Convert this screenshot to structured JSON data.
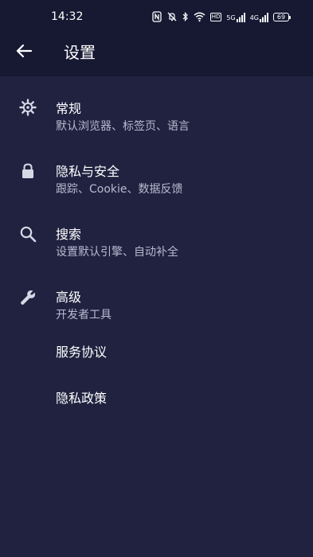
{
  "status_bar": {
    "time": "14:32",
    "network_5g": "5G",
    "network_4g": "4G",
    "hd": "HD",
    "battery": "69"
  },
  "app_bar": {
    "title": "设置"
  },
  "settings": {
    "items": [
      {
        "title": "常规",
        "subtitle": "默认浏览器、标签页、语言"
      },
      {
        "title": "隐私与安全",
        "subtitle": "跟踪、Cookie、数据反馈"
      },
      {
        "title": "搜索",
        "subtitle": "设置默认引擎、自动补全"
      },
      {
        "title": "高级",
        "subtitle": "开发者工具"
      },
      {
        "title": "服务协议"
      },
      {
        "title": "隐私政策"
      }
    ]
  },
  "icons": {
    "back": "arrow-left-icon",
    "general": "gear-icon",
    "privacy": "lock-icon",
    "search": "search-icon",
    "advanced": "wrench-icon"
  },
  "colors": {
    "background": "#202240",
    "bar": "#171933",
    "text_primary": "#ffffff",
    "text_secondary": "#b8bbcf",
    "icon": "#d6d8e6"
  }
}
